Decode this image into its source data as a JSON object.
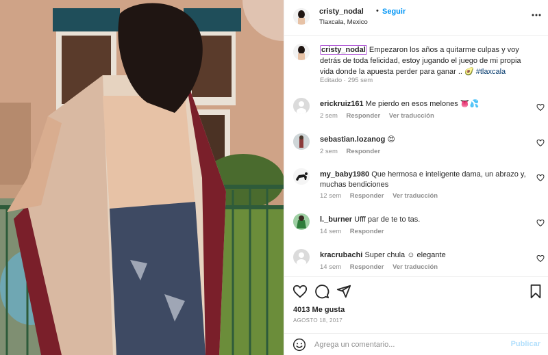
{
  "header": {
    "username": "cristy_nodal",
    "separator": "•",
    "follow_label": "Seguir",
    "location": "Tlaxcala, Mexico",
    "more_icon": "more-horizontal-icon"
  },
  "caption": {
    "username": "cristy_nodal",
    "text": "Empezaron los años a quitarme culpas y voy detrás de toda felicidad, estoy jugando el juego de mi propia vida donde la apuesta perder para ganar .. 🥑 ",
    "hashtag": "#tlaxcala",
    "edited": "Editado",
    "time": "295 sem"
  },
  "comments": [
    {
      "username": "erickruiz161",
      "text": "Me pierdo en esos melones 👅💦",
      "time": "2 sem",
      "reply": "Responder",
      "translate": "Ver traducción"
    },
    {
      "username": "sebastian.lozanog",
      "text": "😍",
      "time": "2 sem",
      "reply": "Responder",
      "translate": ""
    },
    {
      "username": "my_baby1980",
      "text": "Que hermosa e inteligente dama, un abrazo y, muchas bendiciones",
      "time": "12 sem",
      "reply": "Responder",
      "translate": "Ver traducción"
    },
    {
      "username": "l._burner",
      "text": "Ufff par de te to tas.",
      "time": "14 sem",
      "reply": "Responder",
      "translate": ""
    },
    {
      "username": "kracrubachi",
      "text": "Super chula ☺ elegante",
      "time": "14 sem",
      "reply": "Responder",
      "translate": "Ver traducción"
    }
  ],
  "actions": {
    "likes": "4013 Me gusta",
    "date": "AGOSTO 18, 2017",
    "icons": [
      "heart-icon",
      "comment-icon",
      "share-icon",
      "bookmark-icon"
    ]
  },
  "comment_box": {
    "placeholder": "Agrega un comentario...",
    "publish_label": "Publicar"
  },
  "colors": {
    "accent": "#0095f6",
    "publish_disabled": "#b2dffc",
    "muted": "#8e8e8e",
    "hashtag": "#00376b"
  }
}
